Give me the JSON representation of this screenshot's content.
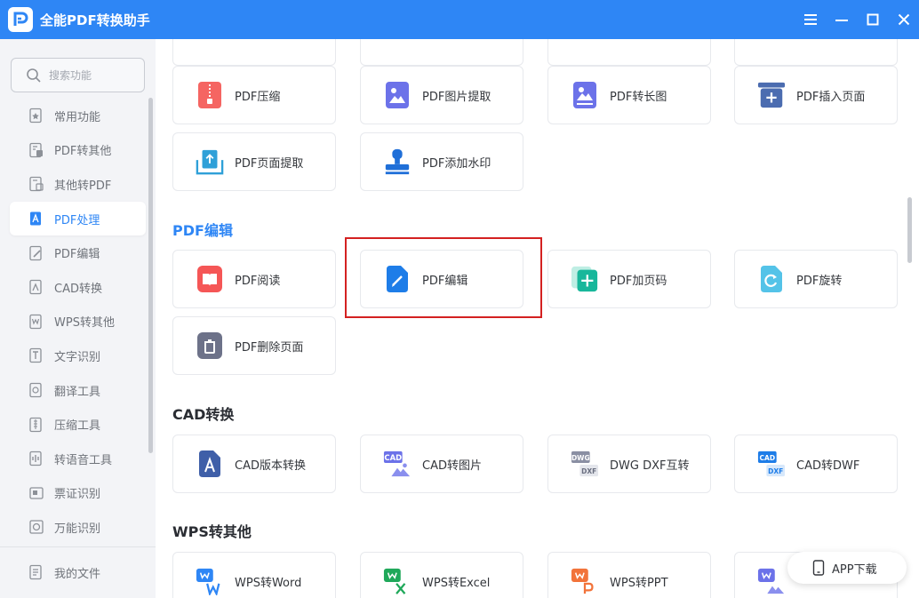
{
  "window": {
    "title": "全能PDF转换助手",
    "controls": [
      "menu-icon",
      "minimize-icon",
      "maximize-icon",
      "close-icon"
    ]
  },
  "sidebar": {
    "search_placeholder": "搜索功能",
    "items": [
      {
        "label": "常用功能",
        "icon": "star-doc-icon",
        "active": false
      },
      {
        "label": "PDF转其他",
        "icon": "pdf-export-icon",
        "active": false
      },
      {
        "label": "其他转PDF",
        "icon": "pdf-import-icon",
        "active": false
      },
      {
        "label": "PDF处理",
        "icon": "pdf-process-icon",
        "active": true
      },
      {
        "label": "PDF编辑",
        "icon": "pdf-edit-icon",
        "active": false
      },
      {
        "label": "CAD转换",
        "icon": "cad-icon",
        "active": false
      },
      {
        "label": "WPS转其他",
        "icon": "wps-icon",
        "active": false
      },
      {
        "label": "文字识别",
        "icon": "text-recognition-icon",
        "active": false
      },
      {
        "label": "翻译工具",
        "icon": "translate-icon",
        "active": false
      },
      {
        "label": "压缩工具",
        "icon": "compress-icon",
        "active": false
      },
      {
        "label": "转语音工具",
        "icon": "speech-icon",
        "active": false
      },
      {
        "label": "票证识别",
        "icon": "ticket-icon",
        "active": false
      },
      {
        "label": "万能识别",
        "icon": "universal-recognition-icon",
        "active": false
      }
    ],
    "my_files": {
      "label": "我的文件",
      "icon": "my-files-icon"
    }
  },
  "main": {
    "sections": {
      "pdf_edit": "PDF编辑",
      "cad": "CAD转换",
      "wps": "WPS转其他"
    },
    "cards": {
      "compress": "PDF压缩",
      "image_extract": "PDF图片提取",
      "to_long_image": "PDF转长图",
      "insert_page": "PDF插入页面",
      "page_extract": "PDF页面提取",
      "watermark": "PDF添加水印",
      "read": "PDF阅读",
      "edit": "PDF编辑",
      "add_page_number": "PDF加页码",
      "rotate": "PDF旋转",
      "delete_page": "PDF删除页面",
      "cad_version": "CAD版本转换",
      "cad_to_image": "CAD转图片",
      "dwg_dxf": "DWG DXF互转",
      "cad_to_dwf": "CAD转DWF",
      "wps_word": "WPS转Word",
      "wps_excel": "WPS转Excel",
      "wps_ppt": "WPS转PPT"
    },
    "icon_badges": {
      "cad": "CAD",
      "dwg": "DWG",
      "dxf": "DXF"
    },
    "app_download": "APP下载"
  },
  "colors": {
    "accent": "#2e86f5",
    "highlight": "#d42121"
  }
}
